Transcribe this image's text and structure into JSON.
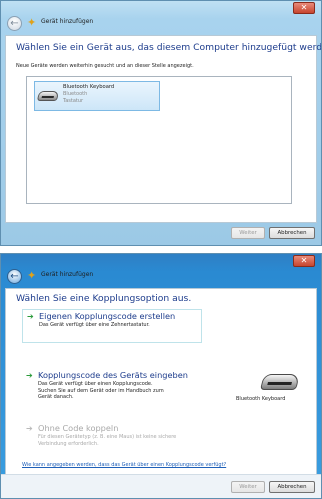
{
  "window1": {
    "title": "Gerät hinzufügen",
    "heading": "Wählen Sie ein Gerät aus, das diesem Computer hinzugefügt werden soll.",
    "subtext": "Neue Geräte werden weiterhin gesucht und an dieser Stelle angezeigt.",
    "device": {
      "name": "Bluetooth Keyboard",
      "type": "Bluetooth",
      "category": "Tastatur"
    },
    "buttons": {
      "next": "Weiter",
      "cancel": "Abbrechen"
    }
  },
  "window2": {
    "title": "Gerät hinzufügen",
    "heading": "Wählen Sie eine Kopplungsoption aus.",
    "options": [
      {
        "title": "Eigenen Kopplungscode erstellen",
        "lines": [
          "Das Gerät verfügt über eine Zehnertastatur."
        ]
      },
      {
        "title": "Kopplungscode des Geräts eingeben",
        "lines": [
          "Das Gerät verfügt über einen Kopplungscode.",
          "Suchen Sie auf dem Gerät oder im Handbuch zum",
          "Gerät danach."
        ]
      },
      {
        "title": "Ohne Code koppeln",
        "lines": [
          "Für diesen Gerätetyp (z. B. eine Maus) ist keine sichere",
          "Verbindung erforderlich."
        ]
      }
    ],
    "device_caption": "Bluetooth Keyboard",
    "help_link": "Wie kann angegeben werden, dass das Gerät über einen Kopplungscode verfügt?",
    "buttons": {
      "next": "Weiter",
      "cancel": "Abbrechen"
    }
  },
  "icons": {
    "back": "back-arrow-icon",
    "close": "close-icon",
    "wizard": "wizard-sparkle-icon",
    "option_arrow": "green-arrow-icon",
    "keyboard": "keyboard-icon"
  },
  "colors": {
    "heading_blue": "#1d3c8c",
    "arrow_green": "#2a9a3a",
    "link_blue": "#1e5fb8"
  }
}
